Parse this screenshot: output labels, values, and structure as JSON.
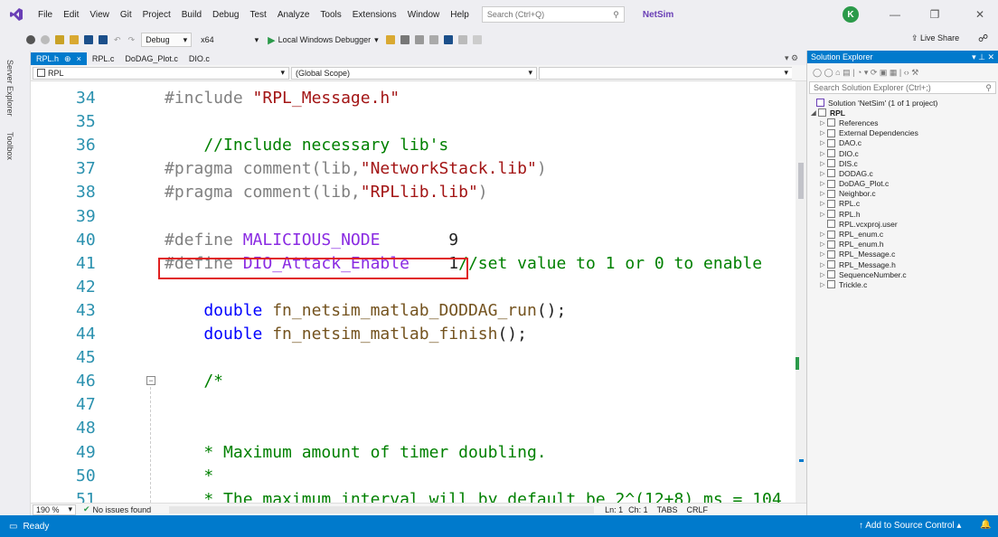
{
  "menu": {
    "items": [
      "File",
      "Edit",
      "View",
      "Git",
      "Project",
      "Build",
      "Debug",
      "Test",
      "Analyze",
      "Tools",
      "Extensions",
      "Window",
      "Help"
    ],
    "search_placeholder": "Search (Ctrl+Q)",
    "solution_name": "NetSim",
    "account_initial": "K"
  },
  "toolbar": {
    "config": "Debug",
    "platform": "x64",
    "run_label": "Local Windows Debugger",
    "live_share": "Live Share"
  },
  "side_tabs": {
    "server_explorer": "Server Explorer",
    "toolbox": "Toolbox"
  },
  "tabs": [
    {
      "label": "RPL.h",
      "active": true,
      "pin": "⊕",
      "close": "×"
    },
    {
      "label": "RPL.c"
    },
    {
      "label": "DoDAG_Plot.c"
    },
    {
      "label": "DIO.c"
    }
  ],
  "navbar": {
    "project": "RPL",
    "scope": "(Global Scope)"
  },
  "editor": {
    "lines": [
      {
        "n": "34",
        "parts": [
          {
            "t": "#include ",
            "c": "c-pp"
          },
          {
            "t": "\"RPL_Message.h\"",
            "c": "c-str"
          }
        ]
      },
      {
        "n": "35",
        "parts": []
      },
      {
        "n": "36",
        "parts": [
          {
            "t": "    //Include necessary lib's",
            "c": "c-cmt"
          }
        ]
      },
      {
        "n": "37",
        "parts": [
          {
            "t": "#pragma comment(lib,",
            "c": "c-pp"
          },
          {
            "t": "\"NetworkStack.lib\"",
            "c": "c-str"
          },
          {
            "t": ")",
            "c": "c-pp"
          }
        ]
      },
      {
        "n": "38",
        "parts": [
          {
            "t": "#pragma comment(lib,",
            "c": "c-pp"
          },
          {
            "t": "\"RPLlib.lib\"",
            "c": "c-str"
          },
          {
            "t": ")",
            "c": "c-pp"
          }
        ]
      },
      {
        "n": "39",
        "parts": []
      },
      {
        "n": "40",
        "parts": [
          {
            "t": "#define ",
            "c": "c-pp"
          },
          {
            "t": "MALICIOUS_NODE",
            "c": "c-mac"
          },
          {
            "t": "       9",
            "c": "c-txt"
          }
        ]
      },
      {
        "n": "41",
        "parts": [
          {
            "t": "#define ",
            "c": "c-pp"
          },
          {
            "t": "DIO_Attack_Enable",
            "c": "c-mac"
          },
          {
            "t": "    1",
            "c": "c-txt"
          },
          {
            "t": "//set value to 1 or 0 to enable",
            "c": "c-cmt"
          }
        ]
      },
      {
        "n": "42",
        "parts": []
      },
      {
        "n": "43",
        "parts": [
          {
            "t": "    double ",
            "c": "c-kw"
          },
          {
            "t": "fn_netsim_matlab_DODDAG_run",
            "c": "c-fn"
          },
          {
            "t": "();",
            "c": "c-txt"
          }
        ]
      },
      {
        "n": "44",
        "parts": [
          {
            "t": "    double ",
            "c": "c-kw"
          },
          {
            "t": "fn_netsim_matlab_finish",
            "c": "c-fn"
          },
          {
            "t": "();",
            "c": "c-txt"
          }
        ]
      },
      {
        "n": "45",
        "parts": []
      },
      {
        "n": "46",
        "parts": [
          {
            "t": "    /*",
            "c": "c-cmt"
          }
        ]
      },
      {
        "n": "47",
        "parts": []
      },
      {
        "n": "48",
        "parts": []
      },
      {
        "n": "49",
        "parts": [
          {
            "t": "    * Maximum amount of timer doubling.",
            "c": "c-cmt"
          }
        ]
      },
      {
        "n": "50",
        "parts": [
          {
            "t": "    *",
            "c": "c-cmt"
          }
        ]
      },
      {
        "n": "51",
        "parts": [
          {
            "t": "    * The maximum interval will by default be 2^(12+8) ms = 104",
            "c": "c-cmt"
          }
        ]
      }
    ]
  },
  "editor_status": {
    "zoom": "190 %",
    "issues": "No issues found",
    "ln": "Ln: 1",
    "ch": "Ch: 1",
    "tabs": "TABS",
    "eol": "CRLF"
  },
  "solution_explorer": {
    "title": "Solution Explorer",
    "search_placeholder": "Search Solution Explorer (Ctrl+;)",
    "solution_label": "Solution 'NetSim' (1 of 1 project)",
    "project": "RPL",
    "items": [
      "References",
      "External Dependencies",
      "DAO.c",
      "DIO.c",
      "DIS.c",
      "DODAG.c",
      "DoDAG_Plot.c",
      "Neighbor.c",
      "RPL.c",
      "RPL.h",
      "RPL.vcxproj.user",
      "RPL_enum.c",
      "RPL_enum.h",
      "RPL_Message.c",
      "RPL_Message.h",
      "SequenceNumber.c",
      "Trickle.c"
    ]
  },
  "statusbar": {
    "ready": "Ready",
    "source_control": "Add to Source Control"
  },
  "colors": {
    "accent": "#007acc",
    "highlight_box": "#e02020"
  }
}
